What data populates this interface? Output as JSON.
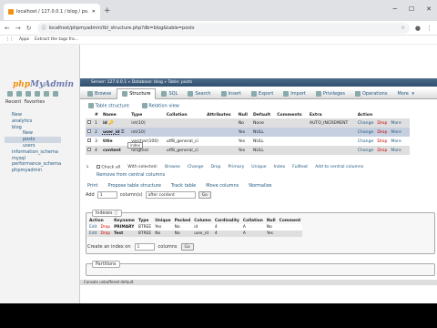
{
  "browser": {
    "tab_title": "localhost / 127.0.0.1 / blog / po...",
    "new_tab": "+",
    "url": "localhost/phpmyadmin/tbl_structure.php?db=blog&table=posts",
    "bookmarks": [
      "Apps",
      "Extract the tags fro..."
    ]
  },
  "sidebar": {
    "logo_php": "php",
    "logo_admin": "MyAdmin",
    "recent": "Recent",
    "favorites": "Favorites",
    "tree": [
      "New",
      "analytics",
      "blog",
      "New",
      "posts",
      "users",
      "information_schema",
      "mysql",
      "performance_schema",
      "phpmyadmin"
    ]
  },
  "main": {
    "breadcrumb": "Server: 127.0.0.1  »  Database: blog  »  Table: posts",
    "tabs": [
      "Browse",
      "Structure",
      "SQL",
      "Search",
      "Insert",
      "Export",
      "Import",
      "Privileges",
      "Operations",
      "More"
    ],
    "subtabs": [
      "Table structure",
      "Relation view"
    ],
    "headers": [
      "#",
      "Name",
      "Type",
      "Collation",
      "Attributes",
      "Null",
      "Default",
      "Comments",
      "Extra",
      "Action"
    ],
    "rows": [
      {
        "n": "1",
        "name": "id",
        "type": "int(10)",
        "coll": "",
        "null": "No",
        "def": "None",
        "extra": "AUTO_INCREMENT"
      },
      {
        "n": "2",
        "name": "user_id",
        "type": "int(10)",
        "coll": "",
        "null": "Yes",
        "def": "NULL",
        "extra": ""
      },
      {
        "n": "3",
        "name": "title",
        "type": "varchar(100)",
        "coll": "utf8_general_ci",
        "null": "Yes",
        "def": "NULL",
        "extra": ""
      },
      {
        "n": "4",
        "name": "content",
        "type": "longtext",
        "coll": "utf8_general_ci",
        "null": "Yes",
        "def": "NULL",
        "extra": ""
      }
    ],
    "actions": [
      "Change",
      "Drop",
      "More"
    ],
    "tooltip": "index",
    "below": [
      "Check all",
      "With selected:",
      "Browse",
      "Change",
      "Drop",
      "Primary",
      "Unique",
      "Index",
      "Fulltext",
      "Add to central columns"
    ],
    "remove_central": "Remove from central columns",
    "line2": [
      "Print",
      "Propose table structure",
      "Track table",
      "Move columns",
      "Normalize"
    ],
    "add": {
      "label": "Add",
      "value": "1",
      "columns": "column(s)",
      "position": "after content",
      "go": "Go"
    },
    "indexes": {
      "title": "Indexes",
      "headers": [
        "Action",
        "Keyname",
        "Type",
        "Unique",
        "Packed",
        "Column",
        "Cardinality",
        "Collation",
        "Null",
        "Comment"
      ],
      "rows": [
        {
          "edit": "Edit",
          "drop": "Drop",
          "key": "PRIMARY",
          "type": "BTREE",
          "uniq": "Yes",
          "packed": "No",
          "col": "id",
          "card": "4",
          "coll": "A",
          "null": "No"
        },
        {
          "edit": "Edit",
          "drop": "Drop",
          "key": "Test",
          "type": "BTREE",
          "uniq": "No",
          "packed": "No",
          "col": "user_id",
          "card": "4",
          "coll": "A",
          "null": "Yes"
        }
      ],
      "create_label": "Create an index on",
      "create_value": "1",
      "create_columns": "columns",
      "go": "Go"
    },
    "partitions": "Partitions",
    "console": "Console unbuffered default"
  }
}
